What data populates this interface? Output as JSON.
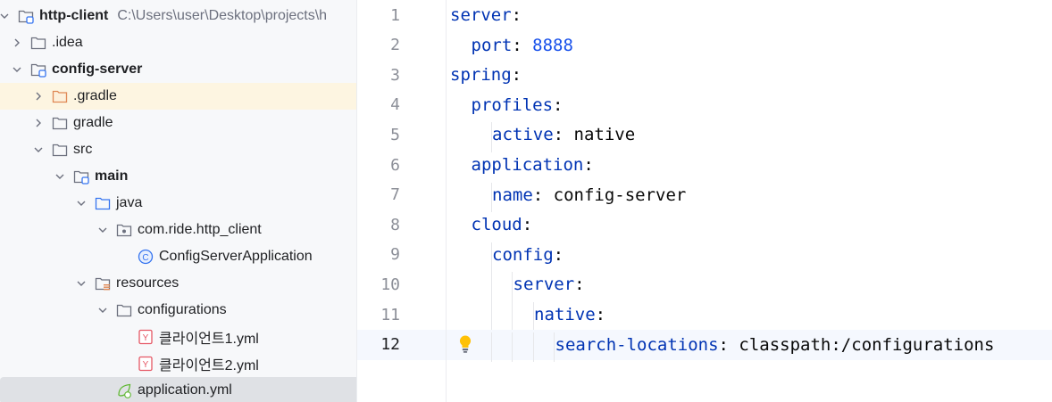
{
  "project": {
    "name": "http-client",
    "path": "C:\\Users\\user\\Desktop\\projects\\h"
  },
  "tree": [
    {
      "label": ".idea",
      "icon": "folder-icon",
      "expanded": false
    },
    {
      "label": "config-server",
      "icon": "module-folder-icon",
      "expanded": true,
      "bold": true
    },
    {
      "label": ".gradle",
      "icon": "folder-orange-icon",
      "expanded": false
    },
    {
      "label": "gradle",
      "icon": "folder-icon",
      "expanded": false
    },
    {
      "label": "src",
      "icon": "folder-icon",
      "expanded": true
    },
    {
      "label": "main",
      "icon": "source-root-folder-icon",
      "expanded": true,
      "bold": true
    },
    {
      "label": "java",
      "icon": "folder-blue-icon",
      "expanded": true
    },
    {
      "label": "com.ride.http_client",
      "icon": "package-icon",
      "expanded": true
    },
    {
      "label": "ConfigServerApplication",
      "icon": "spring-class-icon"
    },
    {
      "label": "resources",
      "icon": "resources-folder-icon",
      "expanded": true
    },
    {
      "label": "configurations",
      "icon": "folder-icon",
      "expanded": true
    },
    {
      "label": "클라이언트1.yml",
      "icon": "yaml-file-icon"
    },
    {
      "label": "클라이언트2.yml",
      "icon": "yaml-file-icon"
    },
    {
      "label": "application.yml",
      "icon": "spring-yaml-icon"
    }
  ],
  "editor": {
    "lines": [
      {
        "no": "1",
        "indent": 0,
        "key": "server",
        "sep": ":",
        "value": ""
      },
      {
        "no": "2",
        "indent": 1,
        "key": "port",
        "sep": ": ",
        "value": "8888",
        "numeric": true
      },
      {
        "no": "3",
        "indent": 0,
        "key": "spring",
        "sep": ":",
        "value": ""
      },
      {
        "no": "4",
        "indent": 1,
        "key": "profiles",
        "sep": ":",
        "value": ""
      },
      {
        "no": "5",
        "indent": 2,
        "key": "active",
        "sep": ": ",
        "value": "native"
      },
      {
        "no": "6",
        "indent": 1,
        "key": "application",
        "sep": ":",
        "value": ""
      },
      {
        "no": "7",
        "indent": 2,
        "key": "name",
        "sep": ": ",
        "value": "config-server"
      },
      {
        "no": "8",
        "indent": 1,
        "key": "cloud",
        "sep": ":",
        "value": ""
      },
      {
        "no": "9",
        "indent": 2,
        "key": "config",
        "sep": ":",
        "value": ""
      },
      {
        "no": "10",
        "indent": 3,
        "key": "server",
        "sep": ":",
        "value": ""
      },
      {
        "no": "11",
        "indent": 4,
        "key": "native",
        "sep": ":",
        "value": ""
      },
      {
        "no": "12",
        "indent": 5,
        "key": "search-locations",
        "sep": ": ",
        "value": "classpath:/configurations"
      }
    ],
    "active_line": "12"
  },
  "colors": {
    "key": "#0033b3",
    "number": "#1750eb",
    "selected_row": "#fdf5e1",
    "current_row": "#dfe1e5"
  }
}
